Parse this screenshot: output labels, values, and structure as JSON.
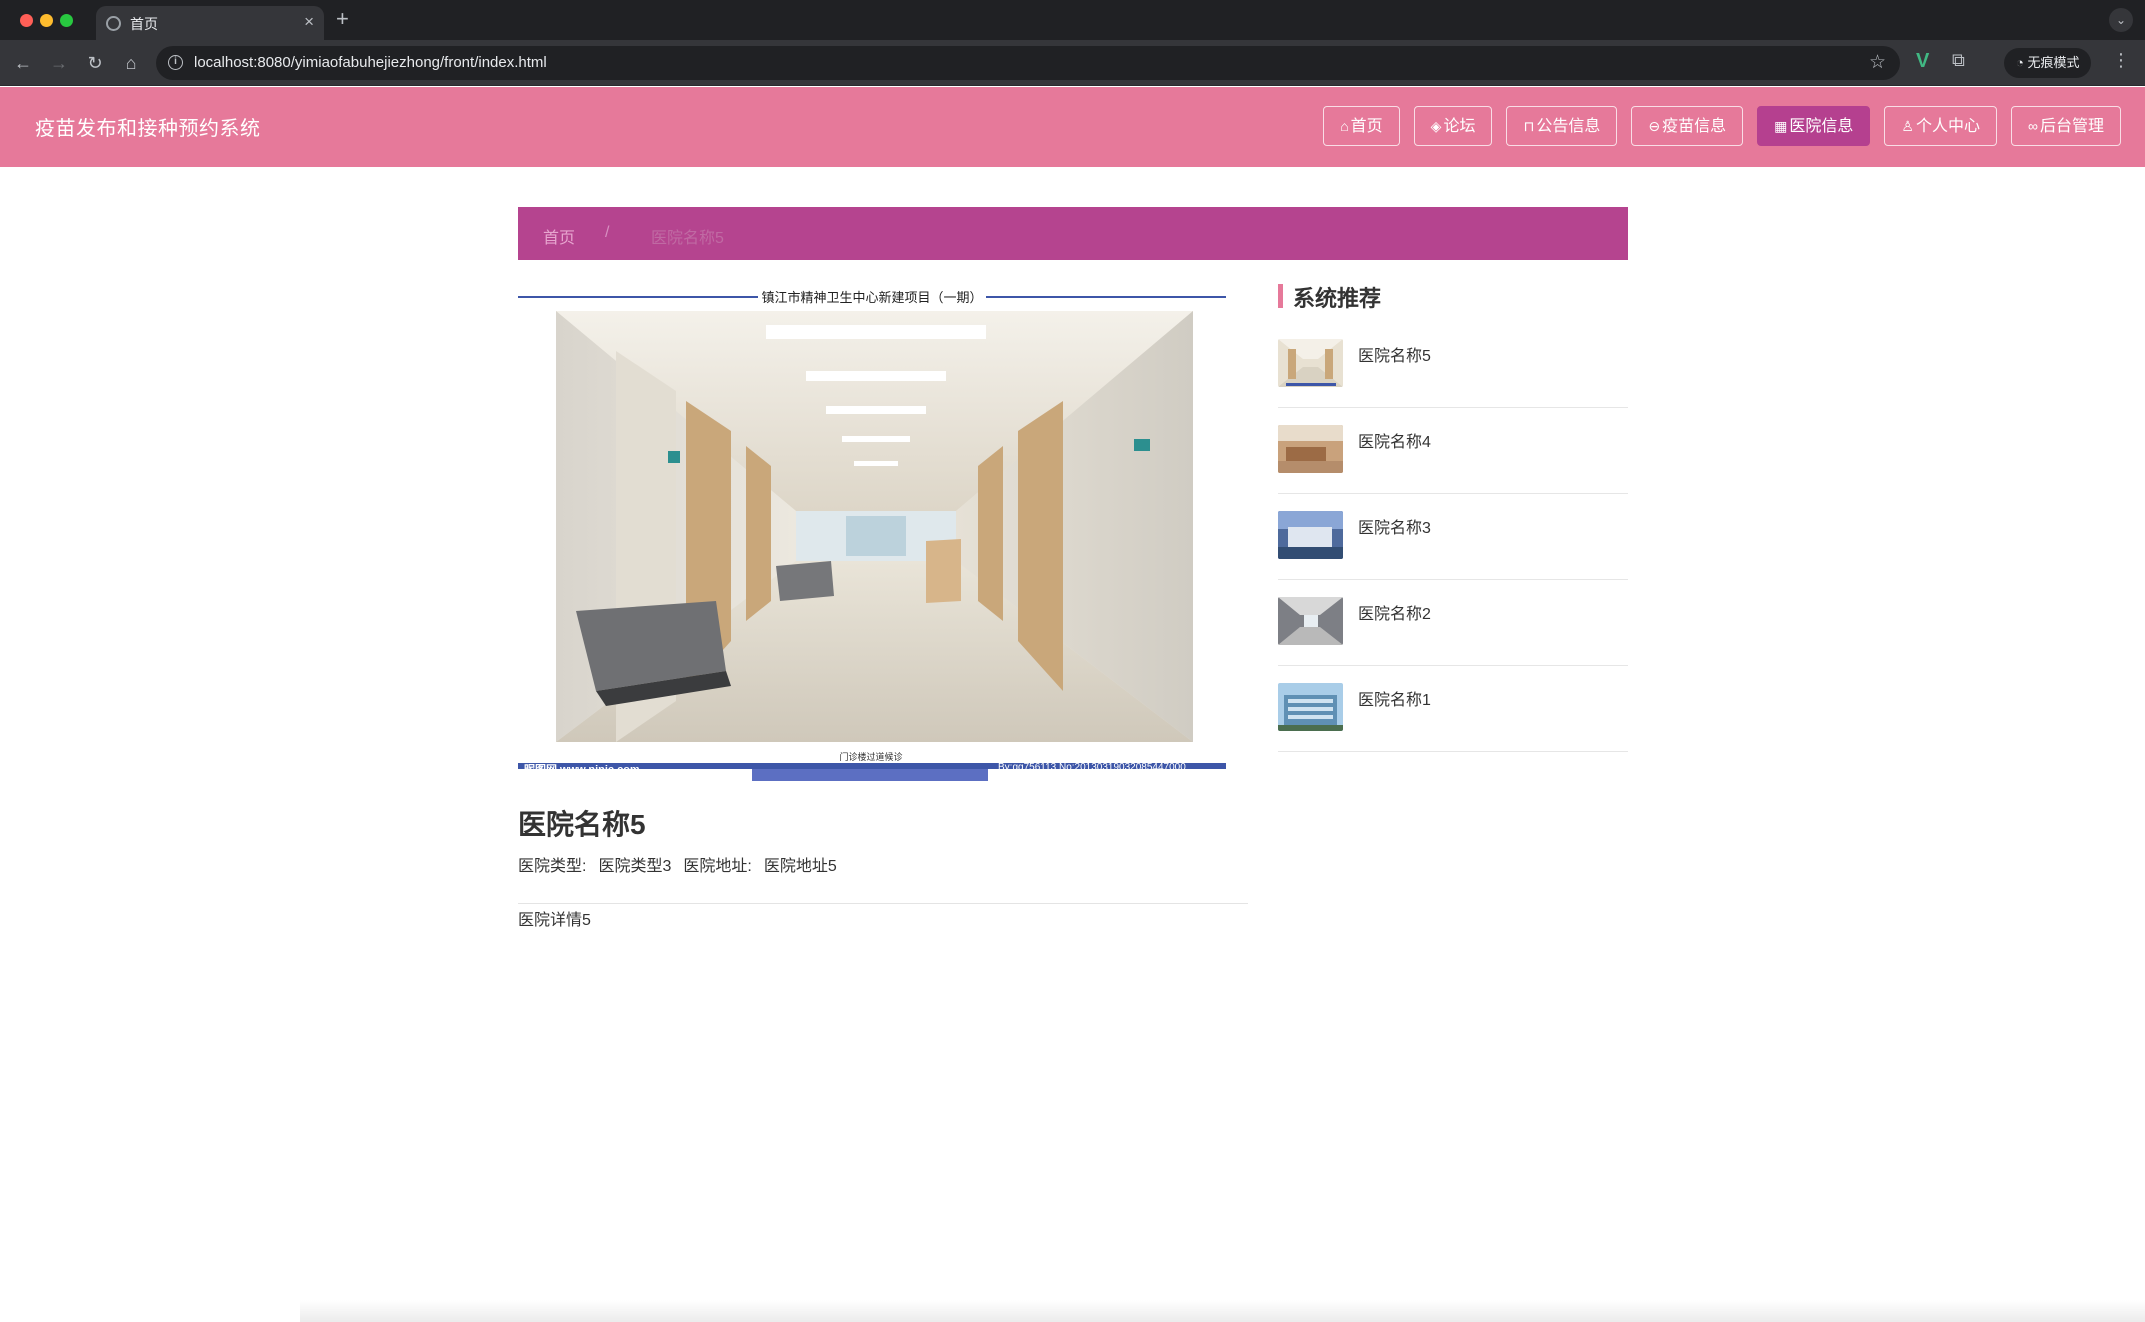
{
  "browser": {
    "tab_title": "首页",
    "url": "localhost:8080/yimiaofabuhejiezhong/front/index.html",
    "incognito_label": "无痕模式"
  },
  "header": {
    "site_title": "疫苗发布和接种预约系统",
    "nav": [
      {
        "label": "首页",
        "icon": "home-icon"
      },
      {
        "label": "论坛",
        "icon": "layers-icon"
      },
      {
        "label": "公告信息",
        "icon": "bank-icon"
      },
      {
        "label": "疫苗信息",
        "icon": "circle-icon"
      },
      {
        "label": "医院信息",
        "icon": "grid-icon",
        "active": true
      },
      {
        "label": "个人中心",
        "icon": "user-icon"
      },
      {
        "label": "后台管理",
        "icon": "link-icon"
      }
    ]
  },
  "breadcrumb": {
    "home": "首页",
    "separator": "/",
    "current": "医院名称5"
  },
  "detail": {
    "image": {
      "caption_top": "镇江市精神卫生中心新建项目（一期）",
      "caption_bottom": "门诊楼过道候诊",
      "watermark_left": "昵图网 www.nipic.com",
      "watermark_right": "By:qq756113  No:20130319032085447000"
    },
    "name": "医院名称5",
    "type_label": "医院类型:",
    "type_value": "医院类型3",
    "address_label": "医院地址:",
    "address_value": "医院地址5",
    "description": "医院详情5"
  },
  "sidebar": {
    "title": "系统推荐",
    "items": [
      {
        "name": "医院名称5"
      },
      {
        "name": "医院名称4"
      },
      {
        "name": "医院名称3"
      },
      {
        "name": "医院名称2"
      },
      {
        "name": "医院名称1"
      }
    ]
  },
  "colors": {
    "header_bg": "#e6799a",
    "accent": "#b5408f",
    "image_frame": "#3d56a8"
  }
}
